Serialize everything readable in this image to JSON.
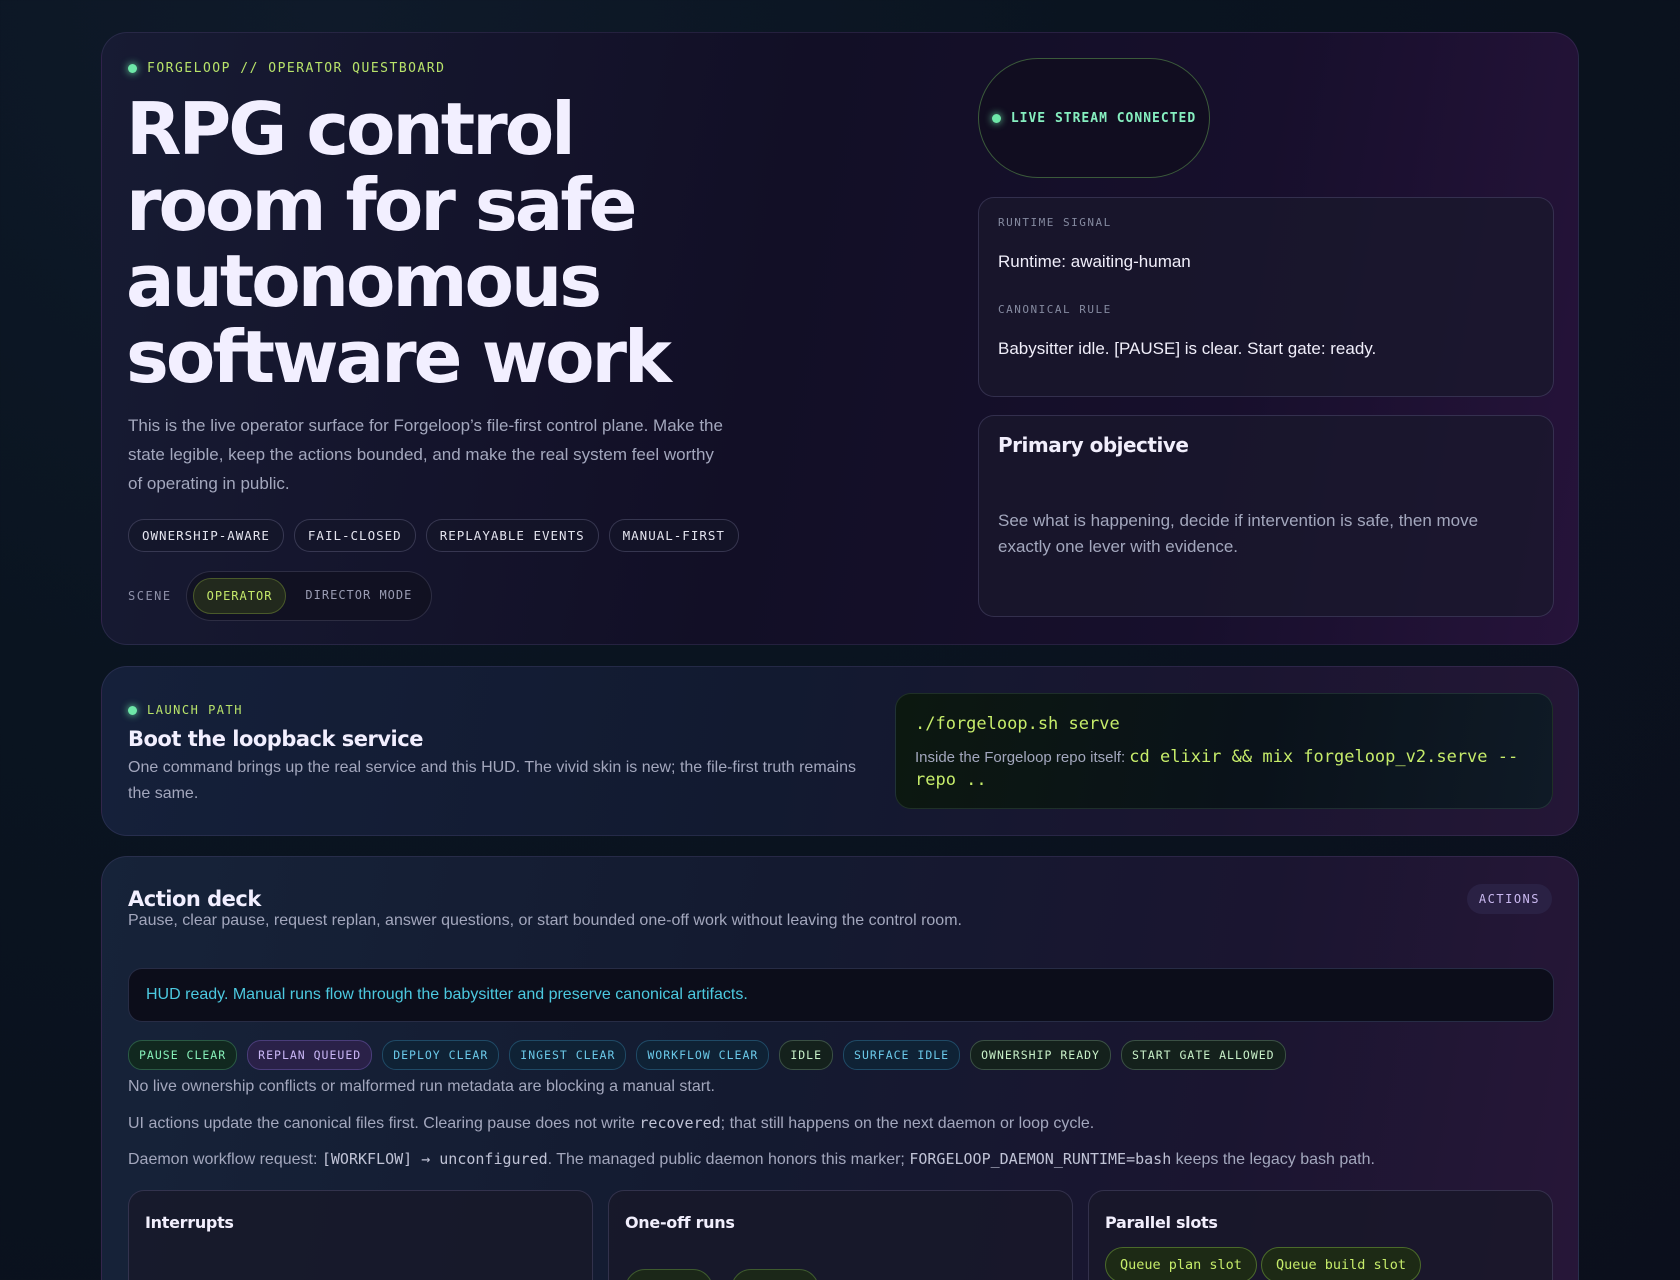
{
  "hero": {
    "eyebrow": "FORGELOOP // OPERATOR QUESTBOARD",
    "title": "RPG control room for safe autonomous software work",
    "description": "This is the live operator surface for Forgeloop’s file-first control plane. Make the state legible, keep the actions bounded, and make the real system feel worthy of operating in public.",
    "tags": [
      "OWNERSHIP-AWARE",
      "FAIL-CLOSED",
      "REPLAYABLE EVENTS",
      "MANUAL-FIRST"
    ],
    "scene_label": "SCENE",
    "scene_options": [
      "OPERATOR",
      "DIRECTOR MODE"
    ],
    "scene_selected": "OPERATOR",
    "live_status": "LIVE STREAM CONNECTED",
    "runtime_signal_label": "RUNTIME SIGNAL",
    "runtime_signal_value": "Runtime: awaiting-human",
    "canonical_rule_label": "CANONICAL RULE",
    "canonical_rule_value": "Babysitter idle. [PAUSE] is clear. Start gate: ready.",
    "objective_title": "Primary objective",
    "objective_text": "See what is happening, decide if intervention is safe, then move exactly one lever with evidence."
  },
  "launch": {
    "eyebrow": "LAUNCH PATH",
    "title": "Boot the loopback service",
    "description": "One command brings up the real service and this HUD. The vivid skin is new; the file-first truth remains the same.",
    "command": "./forgeloop.sh serve",
    "alt_prefix": "Inside the Forgeloop repo itself: ",
    "alt_command": "cd elixir && mix forgeloop_v2.serve --repo .."
  },
  "actions": {
    "title": "Action deck",
    "description": "Pause, clear pause, request replan, answer questions, or start bounded one-off work without leaving the control room.",
    "badge": "ACTIONS",
    "hud_message": "HUD ready. Manual runs flow through the babysitter and preserve canonical artifacts.",
    "status_chips": [
      {
        "label": "PAUSE CLEAR",
        "tone": "green"
      },
      {
        "label": "REPLAN QUEUED",
        "tone": "purple"
      },
      {
        "label": "DEPLOY CLEAR",
        "tone": "teal"
      },
      {
        "label": "INGEST CLEAR",
        "tone": "teal"
      },
      {
        "label": "WORKFLOW CLEAR",
        "tone": "teal"
      },
      {
        "label": "IDLE",
        "tone": "gray"
      },
      {
        "label": "SURFACE IDLE",
        "tone": "teal"
      },
      {
        "label": "OWNERSHIP READY",
        "tone": "gray"
      },
      {
        "label": "START GATE ALLOWED",
        "tone": "gray"
      }
    ],
    "note1": "No live ownership conflicts or malformed run metadata are blocking a manual start.",
    "note2_a": "UI actions update the canonical files first. Clearing pause does not write ",
    "note2_code": "recovered",
    "note2_b": "; that still happens on the next daemon or loop cycle.",
    "note3_a": "Daemon workflow request: ",
    "note3_code1": "[WORKFLOW] → unconfigured",
    "note3_b": ". The managed public daemon honors this marker; ",
    "note3_code2": "FORGELOOP_DAEMON_RUNTIME=bash",
    "note3_c": " keeps the legacy bash path.",
    "cards": {
      "interrupts": "Interrupts",
      "oneoff": "One-off runs",
      "parallel": "Parallel slots",
      "queue_plan": "Queue plan slot",
      "queue_build": "Queue build slot"
    }
  },
  "colors": {
    "accent_lime": "#c6ec6a",
    "accent_green": "#6ee7a8",
    "accent_teal": "#4cc9e0"
  }
}
